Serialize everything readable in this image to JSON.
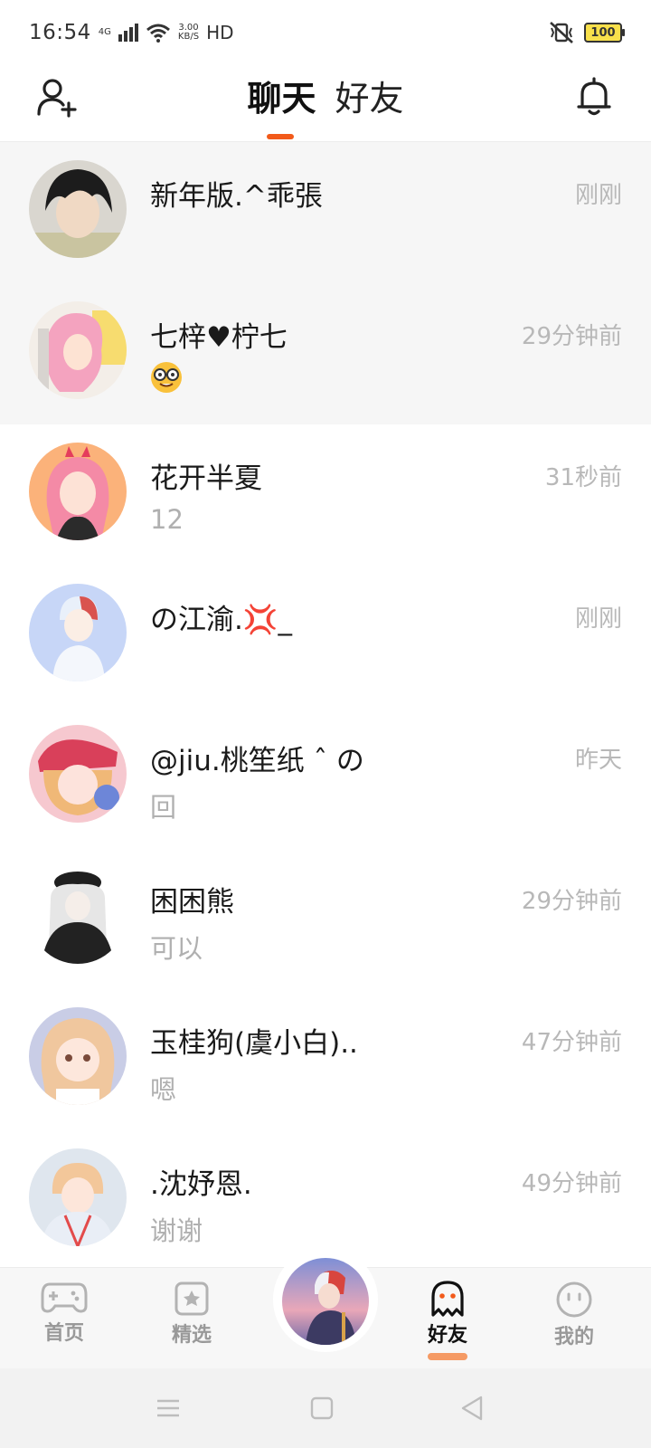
{
  "status_bar": {
    "time": "16:54",
    "network": "4G",
    "speed_value": "3.00",
    "speed_unit": "KB/S",
    "hd": "HD",
    "battery": "100"
  },
  "header": {
    "tabs": [
      {
        "label": "聊天",
        "active": true
      },
      {
        "label": "好友",
        "active": false
      }
    ],
    "accent_color": "#f25a1a"
  },
  "chats": [
    {
      "name": "新年版.^乖張",
      "preview": "",
      "time": "刚刚",
      "pinned": true
    },
    {
      "name": "七梓♥柠七",
      "preview": "",
      "time": "29分钟前",
      "pinned": true,
      "preview_icon": "nerd-face-emoji"
    },
    {
      "name": "花开半夏",
      "preview": "12",
      "time": "31秒前",
      "pinned": false
    },
    {
      "name": "の江渝.💢_",
      "preview": "",
      "time": "刚刚",
      "pinned": false
    },
    {
      "name": "@jiu.桃笙纸 ˆ の",
      "preview": "回",
      "time": "昨天",
      "pinned": false
    },
    {
      "name": "困困熊",
      "preview": "可以",
      "time": "29分钟前",
      "pinned": false
    },
    {
      "name": "玉桂狗(虞小白)..",
      "preview": "嗯",
      "time": "47分钟前",
      "pinned": false
    },
    {
      "name": ".沈妤恩.",
      "preview": "谢谢",
      "time": "49分钟前",
      "pinned": false
    }
  ],
  "bottom_nav": {
    "items": [
      {
        "label": "首页",
        "icon": "gamepad-icon"
      },
      {
        "label": "精选",
        "icon": "star-bookmark-icon"
      },
      {
        "label": "",
        "icon": "center-avatar"
      },
      {
        "label": "好友",
        "icon": "ghost-icon",
        "active": true
      },
      {
        "label": "我的",
        "icon": "smiley-icon"
      }
    ]
  }
}
